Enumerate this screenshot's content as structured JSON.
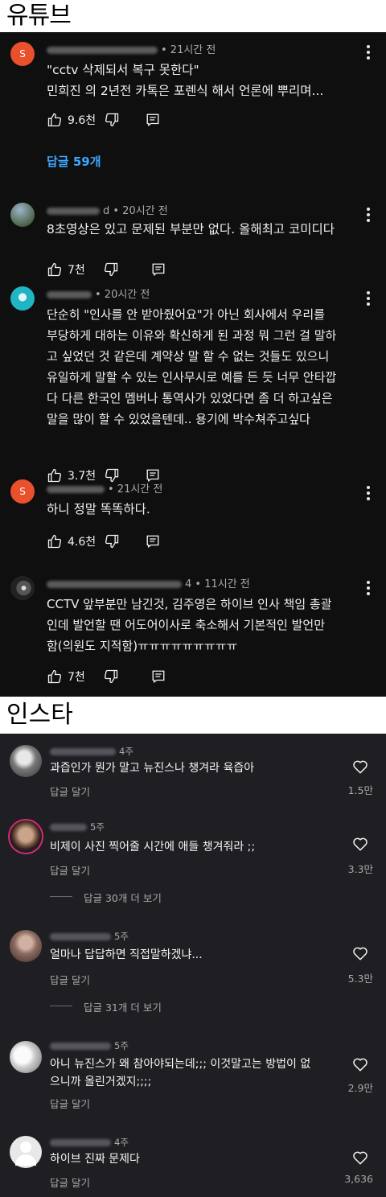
{
  "youtube": {
    "label": "유튜브",
    "comments": [
      {
        "time": "• 21시간 전",
        "line1": "\"cctv 삭제되서 복구 못한다\"",
        "line2": "민희진 의 2년전 카톡은 포렌식 해서 언론에 뿌리며...",
        "likes": "9.6천",
        "avatar_letter": "S",
        "replies": "답글 59개"
      },
      {
        "time": "d • 20시간 전",
        "line1": "8초영상은 있고 문제된 부분만 없다. 올해최고 코미디다",
        "likes": "7천"
      },
      {
        "time": "• 20시간 전",
        "lines": [
          "단순히 \"인사를 안 받아줬어요\"가 아닌 회사에서 우리를",
          "부당하게 대하는 이유와 확신하게 된 과정 뭐 그런 걸 말하",
          "고 싶었던 것 같은데 계약상 말 할 수 없는 것들도 있으니",
          "유일하게 말할 수 있는 인사무시로 예를 든 듯 너무 안타깝",
          "다 다른 한국인 멤버나 통역사가 있었다면 좀 더 하고싶은",
          "말을 많이 할 수 있었을텐데.. 용기에 박수쳐주고싶다"
        ],
        "likes": "3.7천"
      },
      {
        "time": "• 21시간 전",
        "line1": "하니 정말 똑똑하다.",
        "likes": "4.6천",
        "avatar_letter": "S"
      },
      {
        "time": "4 • 11시간 전",
        "lines": [
          "CCTV 앞부분만 남긴것, 김주영은 하이브 인사 책임 총괄",
          "인데 발언할 땐 어도어이사로 축소해서 기본적인 발언만",
          "함(의원도 지적함)ㅠㅠㅠㅠㅠㅠㅠㅠㅠ"
        ],
        "likes": "7천"
      }
    ]
  },
  "instagram": {
    "label": "인스타",
    "reply_action": "답글 달기",
    "comments": [
      {
        "time": "4주",
        "text": "과즙인가 뭔가  말고 뉴진스나 챙겨라 육즙아",
        "likes": "1.5만"
      },
      {
        "time": "5주",
        "text": "비제이 사진 찍어줄 시간에 애들 챙겨줘라 ;;",
        "likes": "3.3만",
        "more": "답글 30개 더 보기"
      },
      {
        "time": "5주",
        "text": "얼마나 답답하면 직접말하겠냐...",
        "likes": "5.3만",
        "more": "답글 31개 더 보기"
      },
      {
        "time": "5주",
        "lines": [
          "아니 뉴진스가 왜 참아야되는데;;; 이것말고는 방법이 없",
          "으니까 올린거겠지;;;;"
        ],
        "likes": "2.9만"
      },
      {
        "time": "4주",
        "text": "하이브 진짜 문제다",
        "likes": "3,636"
      }
    ]
  },
  "colors": {
    "yt_bg": "#0f0f0f",
    "ig_bg": "#1f1f23",
    "link_blue": "#3ea6ff",
    "avatar_orange": "#e9502c"
  }
}
